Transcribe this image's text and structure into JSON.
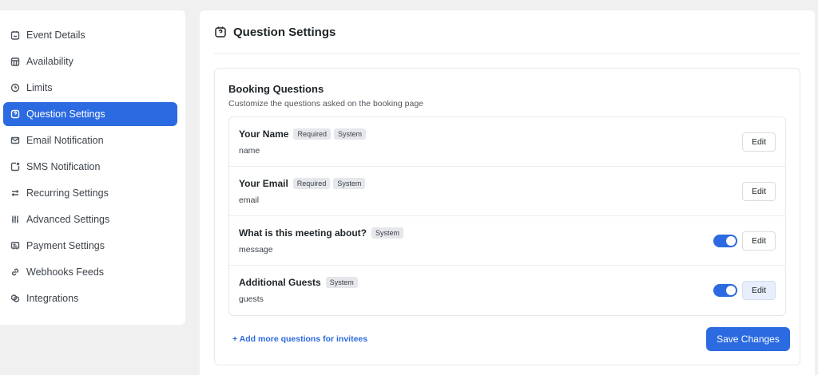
{
  "sidebar": {
    "items": [
      {
        "label": "Event Details",
        "icon": "calendar-edit-icon",
        "active": false
      },
      {
        "label": "Availability",
        "icon": "calendar-grid-icon",
        "active": false
      },
      {
        "label": "Limits",
        "icon": "clock-icon",
        "active": false
      },
      {
        "label": "Question Settings",
        "icon": "question-square-icon",
        "active": true
      },
      {
        "label": "Email Notification",
        "icon": "mail-icon",
        "active": false
      },
      {
        "label": "SMS Notification",
        "icon": "sms-icon",
        "active": false
      },
      {
        "label": "Recurring Settings",
        "icon": "repeat-icon",
        "active": false
      },
      {
        "label": "Advanced Settings",
        "icon": "sliders-icon",
        "active": false
      },
      {
        "label": "Payment Settings",
        "icon": "payment-icon",
        "active": false
      },
      {
        "label": "Webhooks Feeds",
        "icon": "link-icon",
        "active": false
      },
      {
        "label": "Integrations",
        "icon": "integrations-icon",
        "active": false
      }
    ]
  },
  "main": {
    "title": "Question Settings",
    "title_icon": "question-calendar-icon"
  },
  "booking": {
    "title": "Booking Questions",
    "subtitle": "Customize the questions asked on the booking page",
    "questions": [
      {
        "label": "Your Name",
        "badges": [
          "Required",
          "System"
        ],
        "key": "name",
        "toggle": false,
        "toggle_on": false,
        "edit_label": "Edit"
      },
      {
        "label": "Your Email",
        "badges": [
          "Required",
          "System"
        ],
        "key": "email",
        "toggle": false,
        "toggle_on": false,
        "edit_label": "Edit"
      },
      {
        "label": "What is this meeting about?",
        "badges": [
          "System"
        ],
        "key": "message",
        "toggle": true,
        "toggle_on": true,
        "edit_label": "Edit"
      },
      {
        "label": "Additional Guests",
        "badges": [
          "System"
        ],
        "key": "guests",
        "toggle": true,
        "toggle_on": true,
        "edit_label": "Edit"
      }
    ],
    "add_link": "+ Add more questions for invitees",
    "save_label": "Save Changes"
  },
  "colors": {
    "accent": "#2b6ae0",
    "background": "#f0f0f1",
    "badge_bg": "#e5e7eb"
  }
}
